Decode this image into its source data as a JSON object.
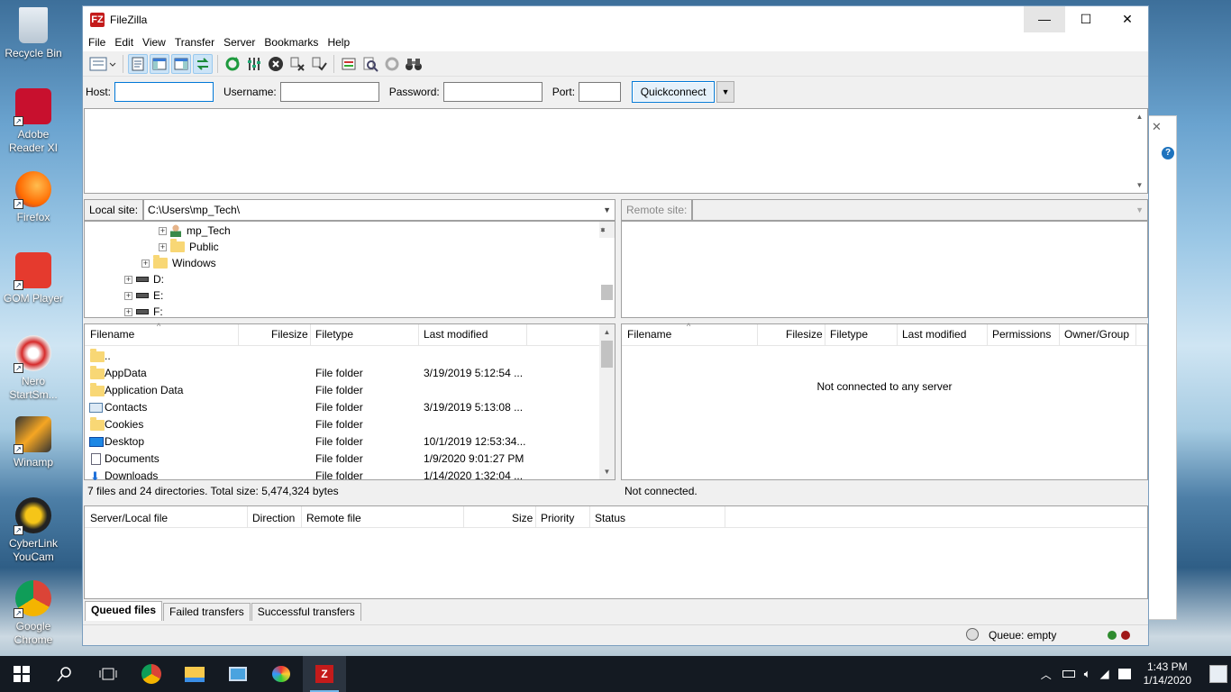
{
  "desktop": {
    "icons": [
      {
        "label": "Recycle Bin",
        "icon": "recycle-bin-icon"
      },
      {
        "label": "Adobe Reader XI",
        "icon": "adobe-reader-icon"
      },
      {
        "label": "Firefox",
        "icon": "firefox-icon"
      },
      {
        "label": "GOM Player",
        "icon": "gom-player-icon"
      },
      {
        "label": "Nero StartSm...",
        "icon": "nero-icon"
      },
      {
        "label": "Winamp",
        "icon": "winamp-icon"
      },
      {
        "label": "CyberLink YouCam",
        "icon": "youcam-icon"
      },
      {
        "label": "Google Chrome",
        "icon": "chrome-icon"
      }
    ]
  },
  "window": {
    "title": "FileZilla",
    "logo": "FZ",
    "controls": {
      "minimize": "—",
      "maximize": "☐",
      "close": "✕"
    }
  },
  "menu": [
    "File",
    "Edit",
    "View",
    "Transfer",
    "Server",
    "Bookmarks",
    "Help"
  ],
  "quickconnect": {
    "host_label": "Host:",
    "host_value": "",
    "username_label": "Username:",
    "username_value": "",
    "password_label": "Password:",
    "password_value": "",
    "port_label": "Port:",
    "port_value": "",
    "button": "Quickconnect"
  },
  "local": {
    "site_label": "Local site:",
    "site_path": "C:\\Users\\mp_Tech\\",
    "tree": [
      {
        "label": "mp_Tech",
        "type": "user"
      },
      {
        "label": "Public",
        "type": "folder"
      },
      {
        "label": "Windows",
        "type": "folder"
      },
      {
        "label": "D:",
        "type": "drive"
      },
      {
        "label": "E:",
        "type": "drive"
      },
      {
        "label": "F:",
        "type": "drive"
      }
    ],
    "columns": [
      "Filename",
      "Filesize",
      "Filetype",
      "Last modified"
    ],
    "files": [
      {
        "name": "..",
        "type": "",
        "modified": ""
      },
      {
        "name": "AppData",
        "type": "File folder",
        "modified": "3/19/2019 5:12:54 ..."
      },
      {
        "name": "Application Data",
        "type": "File folder",
        "modified": ""
      },
      {
        "name": "Contacts",
        "type": "File folder",
        "modified": "3/19/2019 5:13:08 ..."
      },
      {
        "name": "Cookies",
        "type": "File folder",
        "modified": ""
      },
      {
        "name": "Desktop",
        "type": "File folder",
        "modified": "10/1/2019 12:53:34..."
      },
      {
        "name": "Documents",
        "type": "File folder",
        "modified": "1/9/2020 9:01:27 PM"
      },
      {
        "name": "Downloads",
        "type": "File folder",
        "modified": "1/14/2020 1:32:04 ..."
      }
    ],
    "status": "7 files and 24 directories. Total size: 5,474,324 bytes"
  },
  "remote": {
    "site_label": "Remote site:",
    "site_path": "",
    "columns": [
      "Filename",
      "Filesize",
      "Filetype",
      "Last modified",
      "Permissions",
      "Owner/Group"
    ],
    "empty_message": "Not connected to any server",
    "status": "Not connected."
  },
  "queue": {
    "columns": [
      "Server/Local file",
      "Direction",
      "Remote file",
      "Size",
      "Priority",
      "Status"
    ],
    "tabs": [
      "Queued files",
      "Failed transfers",
      "Successful transfers"
    ],
    "status": "Queue: empty"
  },
  "taskbar": {
    "time": "1:43 PM",
    "date": "1/14/2020"
  }
}
